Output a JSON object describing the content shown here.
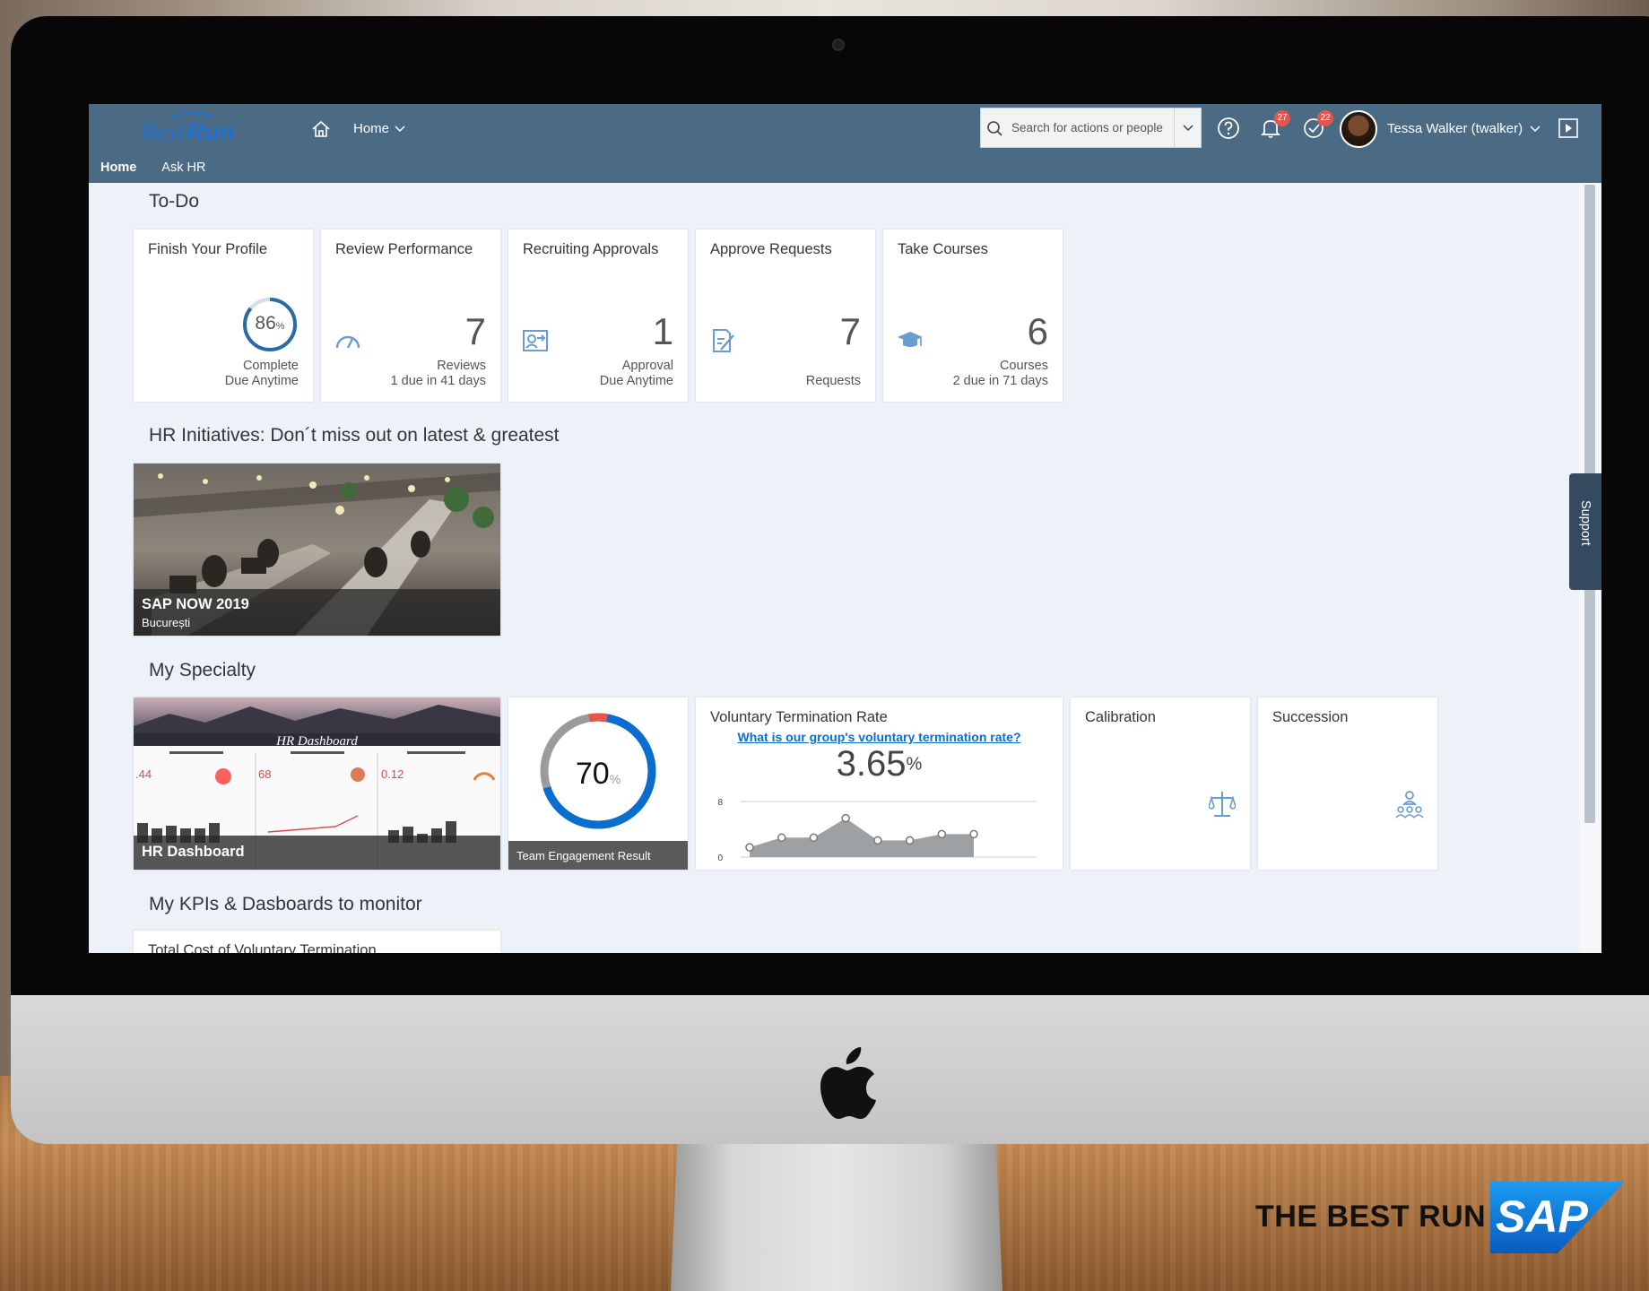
{
  "colors": {
    "shell": "#4b6b84",
    "accent": "#0a6ed1",
    "badge": "#e2564b",
    "content_bg": "#edf2f8"
  },
  "branding": {
    "logo_text_1": "Best",
    "logo_text_2": "Run",
    "tagline": "THE BEST RUN",
    "sap": "SAP"
  },
  "shell": {
    "home_menu": "Home",
    "search_placeholder": "Search for actions or people",
    "notifications_count": "27",
    "todo_count": "22",
    "user_name": "Tessa Walker (twalker)",
    "icons": [
      "home-icon",
      "help-icon",
      "bell-icon",
      "checkmark-icon",
      "exit-icon"
    ]
  },
  "subnav": {
    "items": [
      "Home",
      "Ask HR"
    ],
    "active": "Home"
  },
  "sections": {
    "todo": "To-Do",
    "initiatives": "HR Initiatives: Don´t miss out on latest & greatest",
    "specialty": "My Specialty",
    "kpis": "My KPIs & Dasboards to monitor"
  },
  "todo": [
    {
      "title": "Finish Your Profile",
      "value": "86",
      "unit": "%",
      "progress": 0.86,
      "foot1": "Complete",
      "foot2": "Due Anytime"
    },
    {
      "title": "Review Performance",
      "value": "7",
      "foot1": "Reviews",
      "foot2": "1 due in 41 days",
      "icon": "speedometer-icon"
    },
    {
      "title": "Recruiting Approvals",
      "value": "1",
      "foot1": "Approval",
      "foot2": "Due Anytime",
      "icon": "person-forward-icon"
    },
    {
      "title": "Approve Requests",
      "value": "7",
      "foot1": "Requests",
      "foot2": "",
      "icon": "document-pen-icon"
    },
    {
      "title": "Take Courses",
      "value": "6",
      "foot1": "Courses",
      "foot2": "2 due in 71 days",
      "icon": "graduation-cap-icon"
    }
  ],
  "initiative": {
    "title": "SAP NOW 2019",
    "subtitle": "București"
  },
  "specialty": {
    "dashboard": {
      "label": "HR Dashboard",
      "inner_title": "HR Dashboard",
      "kpis": [
        ".44",
        "68",
        "0.12"
      ]
    },
    "engagement": {
      "value": "70",
      "unit": "%",
      "progress": 0.7,
      "label": "Team Engagement Result"
    },
    "termination": {
      "title": "Voluntary Termination Rate",
      "question": "What is our group's voluntary termination rate?",
      "value": "3.65",
      "unit": "%"
    },
    "calibration": {
      "title": "Calibration",
      "icon": "scale-icon"
    },
    "succession": {
      "title": "Succession",
      "icon": "org-hierarchy-icon"
    }
  },
  "chart_data": {
    "type": "area",
    "title": "",
    "ylim": [
      0,
      8
    ],
    "yticks": [
      "8",
      "0"
    ],
    "values": [
      1.4,
      2.8,
      2.8,
      5.6,
      2.4,
      2.4,
      3.3,
      3.3
    ]
  },
  "kpi_tile": {
    "title": "Total Cost of Voluntary Termination"
  }
}
